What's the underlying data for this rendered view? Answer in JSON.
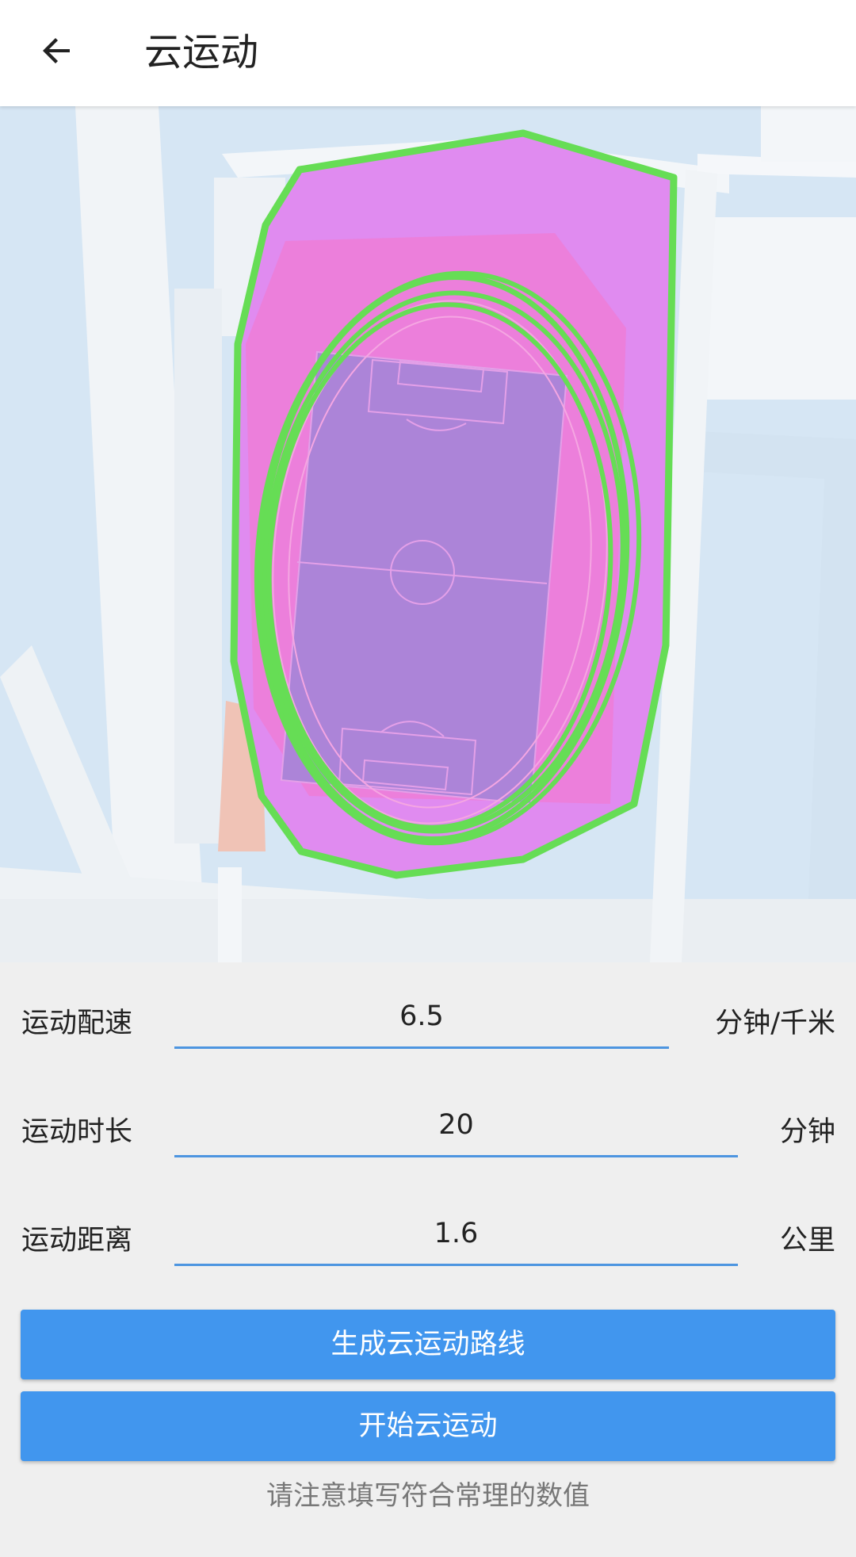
{
  "header": {
    "back_icon": "arrow-left-icon",
    "title": "云运动"
  },
  "map": {
    "track_color": "#66dd55",
    "area_color": "#e08bf0"
  },
  "form": {
    "pace": {
      "label": "运动配速",
      "value": "6.5",
      "unit": "分钟/千米"
    },
    "duration": {
      "label": "运动时长",
      "value": "20",
      "unit": "分钟"
    },
    "distance": {
      "label": "运动距离",
      "value": "1.6",
      "unit": "公里"
    }
  },
  "actions": {
    "generate_label": "生成云运动路线",
    "start_label": "开始云运动"
  },
  "hint": "请注意填写符合常理的数值",
  "colors": {
    "accent": "#4196ee",
    "underline": "#4d95e0"
  }
}
